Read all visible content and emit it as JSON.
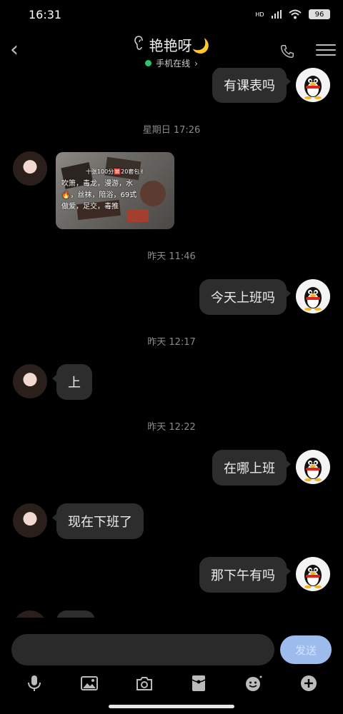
{
  "status_bar": {
    "time": "16:31",
    "network": "HD",
    "battery": "96"
  },
  "header": {
    "contact_name": "艳艳呀🌙",
    "status": "手机在线",
    "status_arrow": "›"
  },
  "messages": {
    "m1": "有课表吗",
    "ts1": "星期日 17:26",
    "image": {
      "caption_title": "十张100分🈲20套包✌",
      "caption_lines": [
        "吹箫，毒龙，漫游，水",
        "🔥，丝袜，陪浴，69式",
        "做爱，足交，毒推"
      ]
    },
    "ts2": "昨天 11:46",
    "m2": "今天上班吗",
    "ts3": "昨天 12:17",
    "m3": "上",
    "ts4": "昨天 12:22",
    "m4": "在哪上班",
    "m5": "现在下班了",
    "m6": "那下午有吗"
  },
  "input": {
    "placeholder": "",
    "send_label": "发送"
  },
  "toolbar": {
    "icons": [
      "mic-icon",
      "image-icon",
      "camera-icon",
      "red-packet-icon",
      "emoji-icon",
      "plus-icon"
    ]
  },
  "colors": {
    "background": "#000000",
    "bubble": "#2d2d2d",
    "online": "#2bc66a",
    "send_button": "#9ebbee"
  }
}
